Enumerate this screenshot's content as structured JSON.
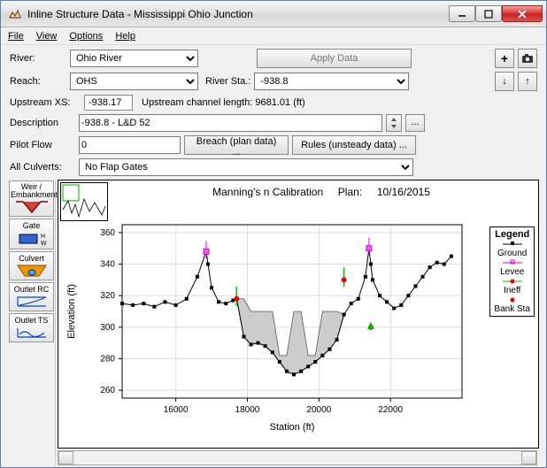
{
  "window": {
    "title": "Inline Structure Data - Mississippi Ohio Junction"
  },
  "menu": {
    "file": "File",
    "view": "View",
    "options": "Options",
    "help": "Help"
  },
  "form": {
    "river_label": "River:",
    "river_value": "Ohio River",
    "apply_data": "Apply Data",
    "reach_label": "Reach:",
    "reach_value": "OHS",
    "river_sta_label": "River Sta.:",
    "river_sta_value": "-938.8",
    "upstream_xs_label": "Upstream XS:",
    "upstream_xs_value": "-938.17",
    "upstream_len_label": "Upstream channel length: 9681.01 (ft)",
    "description_label": "Description",
    "description_value": "-938.8 - L&D 52",
    "pilot_flow_label": "Pilot Flow",
    "pilot_flow_value": "0",
    "breach_btn": "Breach (plan data) ...",
    "rules_btn": "Rules (unsteady data) ...",
    "all_culverts_label": "All Culverts:",
    "all_culverts_value": "No Flap Gates",
    "ellipsis": "..."
  },
  "tools": {
    "weir": "Weir / Embankment",
    "gate": "Gate",
    "culvert": "Culvert",
    "outlet_rc": "Outlet RC",
    "outlet_ts": "Outlet TS"
  },
  "plot": {
    "title_left": "Manning's n Calibration",
    "title_mid": "Plan:",
    "title_right": "10/16/2015",
    "ylabel": "Elevation (ft)",
    "xlabel": "Station (ft)",
    "legend_title": "Legend",
    "legend_ground": "Ground",
    "legend_levee": "Levee",
    "legend_ineff": "Ineff",
    "legend_bank": "Bank Sta"
  },
  "chart_data": {
    "type": "line",
    "xlabel": "Station (ft)",
    "ylabel": "Elevation (ft)",
    "title": "Manning's n Calibration    Plan:    10/16/2015",
    "xlim": [
      14500,
      24000
    ],
    "ylim": [
      255,
      365
    ],
    "xticks": [
      16000,
      18000,
      20000,
      22000
    ],
    "yticks": [
      260,
      280,
      300,
      320,
      340,
      360
    ],
    "series": [
      {
        "name": "Ground",
        "x": [
          14500,
          14800,
          15100,
          15400,
          15700,
          16000,
          16300,
          16600,
          16850,
          16900,
          17000,
          17200,
          17400,
          17600,
          17700,
          17900,
          18100,
          18300,
          18500,
          18700,
          18900,
          19100,
          19300,
          19500,
          19700,
          19900,
          20100,
          20300,
          20500,
          20700,
          20900,
          21100,
          21300,
          21400,
          21450,
          21500,
          21700,
          21900,
          22100,
          22300,
          22500,
          22700,
          22900,
          23100,
          23300,
          23500,
          23700
        ],
        "y": [
          315,
          314,
          315,
          313,
          316,
          314,
          318,
          332,
          348,
          340,
          325,
          316,
          315,
          317,
          318,
          294,
          289,
          290,
          288,
          284,
          278,
          272,
          270,
          272,
          275,
          278,
          282,
          286,
          292,
          308,
          315,
          318,
          332,
          350,
          340,
          330,
          320,
          316,
          312,
          314,
          320,
          326,
          332,
          338,
          341,
          340,
          345
        ]
      }
    ],
    "levee_points_x": [
      16850,
      21400
    ],
    "levee_points_y": [
      348,
      350
    ],
    "ineff_points_x": [
      17700,
      20700
    ],
    "ineff_points_y": [
      318,
      330
    ],
    "bank_sta_x": [
      21450
    ],
    "bank_sta_y": [
      300
    ],
    "ineff_fill_x": [
      17700,
      17900,
      18100,
      18300,
      18500,
      18700,
      18900,
      19100,
      19300,
      19500,
      19700,
      19900,
      20100,
      20300,
      20500,
      20700
    ],
    "ineff_fill_top": [
      318,
      318,
      310,
      310,
      310,
      310,
      282,
      282,
      310,
      310,
      282,
      282,
      310,
      310,
      310,
      308
    ],
    "ineff_fill_bot": [
      318,
      294,
      289,
      290,
      288,
      284,
      278,
      272,
      270,
      272,
      275,
      278,
      282,
      286,
      292,
      308
    ]
  }
}
